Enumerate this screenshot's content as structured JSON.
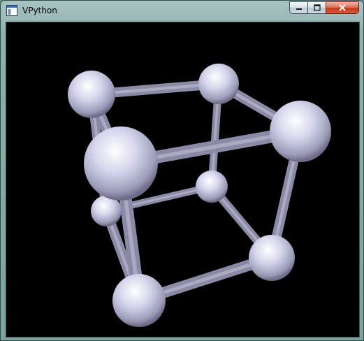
{
  "window": {
    "title": "VPython",
    "controls": [
      {
        "name": "minimize",
        "icon": "minimize-icon"
      },
      {
        "name": "maximize",
        "icon": "maximize-icon"
      },
      {
        "name": "close",
        "icon": "close-icon"
      }
    ]
  },
  "scene": {
    "background": "#000000",
    "sphere_color": "#d8daf0",
    "rod_color": "#8a8aa6"
  }
}
